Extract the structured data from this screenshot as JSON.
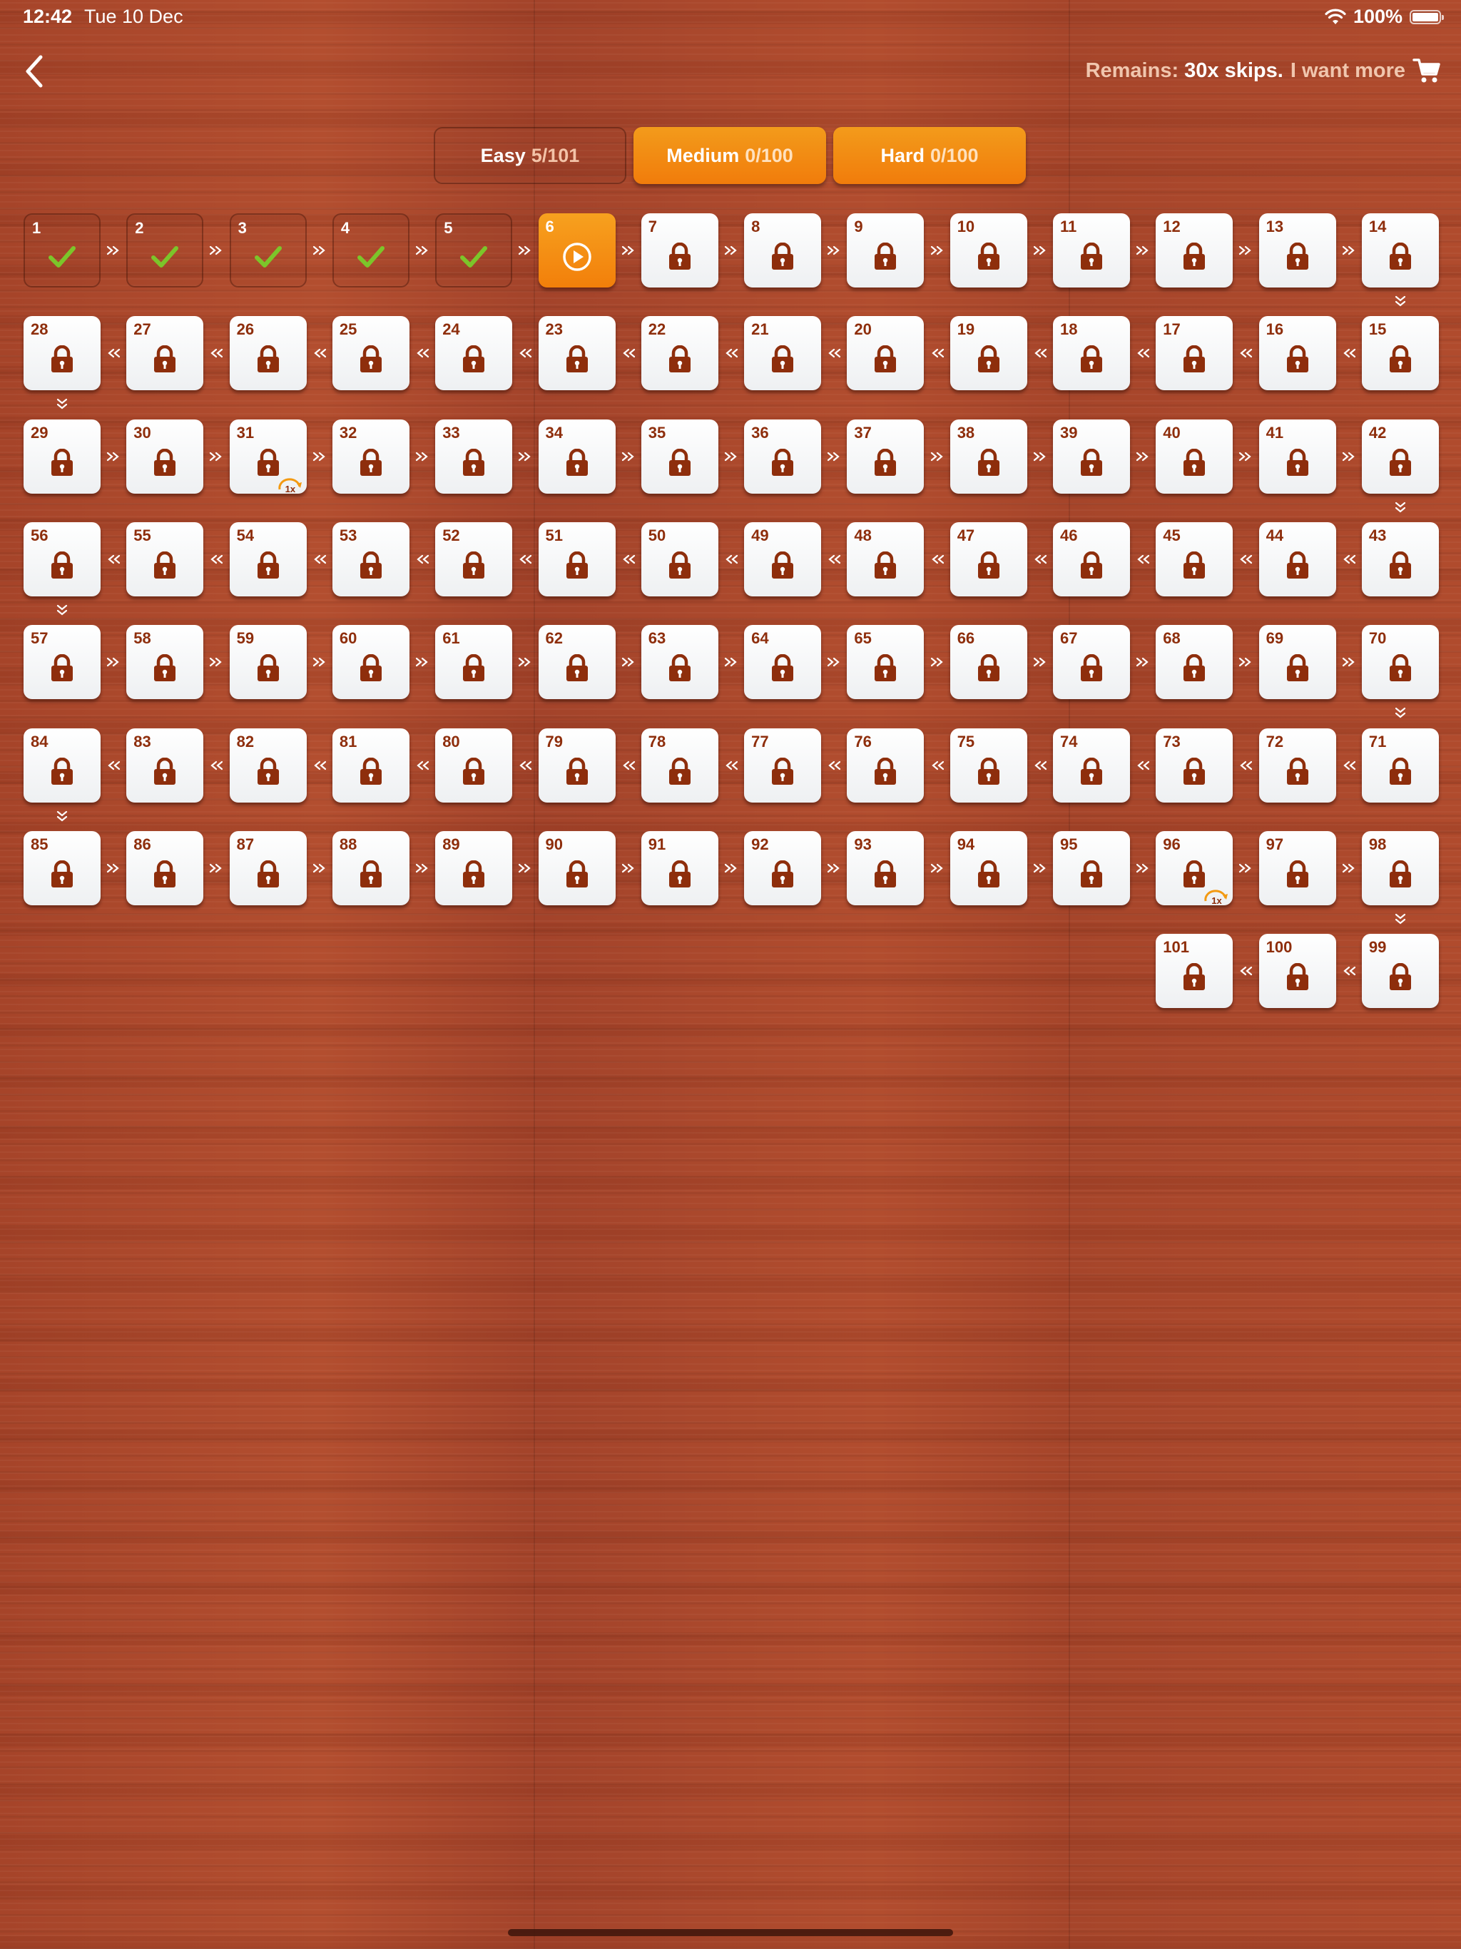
{
  "status_bar": {
    "time": "12:42",
    "date": "Tue 10 Dec",
    "battery": "100%"
  },
  "header": {
    "back_icon": "chevron-left-icon",
    "remains_label": "Remains:",
    "skips_value": "30x skips",
    "period": ".",
    "more_link": "I want more",
    "cart_icon": "cart-icon"
  },
  "tabs": [
    {
      "name": "Easy",
      "progress": "5/101",
      "style": "outline"
    },
    {
      "name": "Medium",
      "progress": "0/100",
      "style": "filled"
    },
    {
      "name": "Hard",
      "progress": "0/100",
      "style": "filled"
    }
  ],
  "levels": {
    "total": 101,
    "completed": [
      1,
      2,
      3,
      4,
      5
    ],
    "current": 6,
    "skip_badges": [
      31,
      96
    ],
    "skip_badge_label": "1x",
    "colors": {
      "accent": "#f27f0a",
      "lock": "#8e2e0c",
      "check": "#7cc52a"
    }
  }
}
